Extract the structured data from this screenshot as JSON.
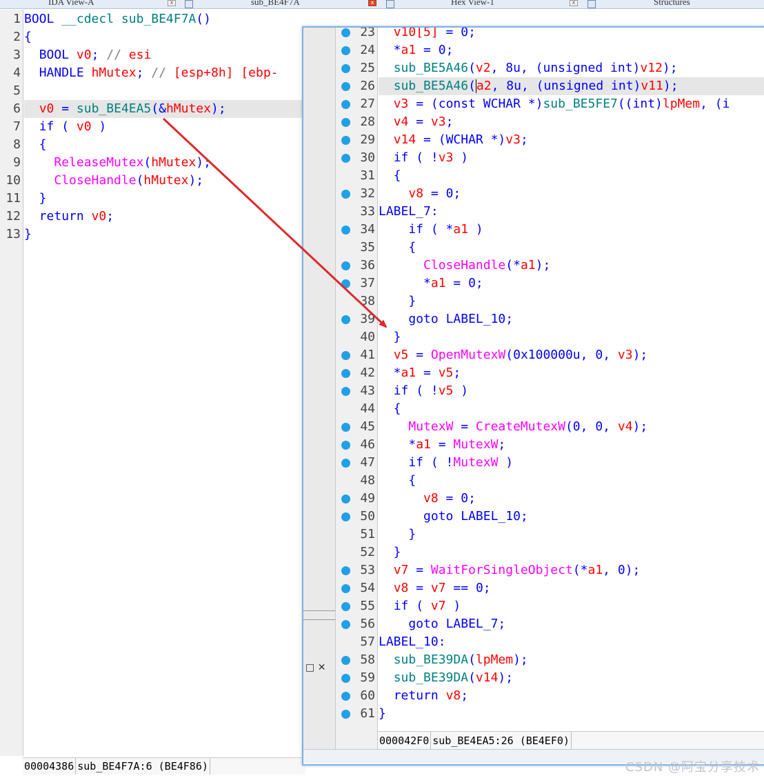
{
  "tabs": [
    {
      "label": "IDA View-A"
    },
    {
      "label": "sub_BE4F7A"
    },
    {
      "label": "Hex View-1"
    },
    {
      "label": "Structures"
    }
  ],
  "left_pane": {
    "lines": [
      {
        "num": "1",
        "tokens": [
          [
            "t",
            "BOOL"
          ],
          [
            "p",
            " "
          ],
          [
            "f",
            "__cdecl"
          ],
          [
            "p",
            " "
          ],
          [
            "f",
            "sub_BE4F7A"
          ],
          [
            "p",
            "()"
          ]
        ]
      },
      {
        "num": "2",
        "tokens": [
          [
            "p",
            "{"
          ]
        ]
      },
      {
        "num": "3",
        "tokens": [
          [
            "p",
            "  "
          ],
          [
            "t",
            "BOOL"
          ],
          [
            "p",
            " "
          ],
          [
            "v",
            "v0"
          ],
          [
            "p",
            "; "
          ],
          [
            "c",
            "// "
          ],
          [
            "cr",
            "esi"
          ]
        ]
      },
      {
        "num": "4",
        "tokens": [
          [
            "p",
            "  "
          ],
          [
            "t",
            "HANDLE"
          ],
          [
            "p",
            " "
          ],
          [
            "v",
            "hMutex"
          ],
          [
            "p",
            "; "
          ],
          [
            "c",
            "// "
          ],
          [
            "cr",
            "[esp+8h] [ebp-"
          ]
        ]
      },
      {
        "num": "5",
        "tokens": []
      },
      {
        "num": "6",
        "highlight": true,
        "tokens": [
          [
            "p",
            "  "
          ],
          [
            "v",
            "v0"
          ],
          [
            "p",
            " = "
          ],
          [
            "f",
            "sub_BE4EA5"
          ],
          [
            "p",
            "(&"
          ],
          [
            "v",
            "hMutex"
          ],
          [
            "p",
            ");"
          ]
        ]
      },
      {
        "num": "7",
        "tokens": [
          [
            "p",
            "  "
          ],
          [
            "k",
            "if"
          ],
          [
            "p",
            " ( "
          ],
          [
            "v",
            "v0"
          ],
          [
            "p",
            " )"
          ]
        ]
      },
      {
        "num": "8",
        "tokens": [
          [
            "p",
            "  {"
          ]
        ]
      },
      {
        "num": "9",
        "tokens": [
          [
            "p",
            "    "
          ],
          [
            "api",
            "ReleaseMutex"
          ],
          [
            "p",
            "("
          ],
          [
            "v",
            "hMutex"
          ],
          [
            "p",
            ");"
          ]
        ]
      },
      {
        "num": "10",
        "tokens": [
          [
            "p",
            "    "
          ],
          [
            "api",
            "CloseHandle"
          ],
          [
            "p",
            "("
          ],
          [
            "v",
            "hMutex"
          ],
          [
            "p",
            ");"
          ]
        ]
      },
      {
        "num": "11",
        "tokens": [
          [
            "p",
            "  }"
          ]
        ]
      },
      {
        "num": "12",
        "tokens": [
          [
            "p",
            "  "
          ],
          [
            "k",
            "return"
          ],
          [
            "p",
            " "
          ],
          [
            "v",
            "v0"
          ],
          [
            "p",
            ";"
          ]
        ]
      },
      {
        "num": "13",
        "tokens": [
          [
            "p",
            "}"
          ]
        ]
      }
    ],
    "status": {
      "address": "00004386",
      "location": "sub_BE4F7A:6",
      "ea": "(BE4F86)"
    }
  },
  "popup": {
    "lines": [
      {
        "num": "23",
        "dot": true,
        "tokens": [
          [
            "p",
            "  "
          ],
          [
            "v",
            "v10[5]"
          ],
          [
            "p",
            " = "
          ],
          [
            "n",
            "0"
          ],
          [
            "p",
            ";"
          ]
        ]
      },
      {
        "num": "24",
        "dot": true,
        "tokens": [
          [
            "p",
            "  *"
          ],
          [
            "v",
            "a1"
          ],
          [
            "p",
            " = "
          ],
          [
            "n",
            "0"
          ],
          [
            "p",
            ";"
          ]
        ]
      },
      {
        "num": "25",
        "dot": true,
        "tokens": [
          [
            "p",
            "  "
          ],
          [
            "f",
            "sub_BE5A46"
          ],
          [
            "p",
            "("
          ],
          [
            "v",
            "v2"
          ],
          [
            "p",
            ", "
          ],
          [
            "n",
            "8u"
          ],
          [
            "p",
            ", ("
          ],
          [
            "t",
            "unsigned int"
          ],
          [
            "p",
            ")"
          ],
          [
            "v",
            "v12"
          ],
          [
            "p",
            ");"
          ]
        ]
      },
      {
        "num": "26",
        "dot": true,
        "highlight": true,
        "caret": true,
        "tokens": [
          [
            "p",
            "  "
          ],
          [
            "f",
            "sub_BE5A46"
          ],
          [
            "p",
            "("
          ],
          [
            "caret",
            ""
          ],
          [
            "v",
            "a2"
          ],
          [
            "p",
            ", "
          ],
          [
            "n",
            "8u"
          ],
          [
            "p",
            ", ("
          ],
          [
            "t",
            "unsigned int"
          ],
          [
            "p",
            ")"
          ],
          [
            "v",
            "v11"
          ],
          [
            "p",
            ");"
          ]
        ]
      },
      {
        "num": "27",
        "dot": true,
        "tokens": [
          [
            "p",
            "  "
          ],
          [
            "v",
            "v3"
          ],
          [
            "p",
            " = ("
          ],
          [
            "t",
            "const"
          ],
          [
            "p",
            " "
          ],
          [
            "t",
            "WCHAR"
          ],
          [
            "p",
            " *)"
          ],
          [
            "f",
            "sub_BE5FE7"
          ],
          [
            "p",
            "(("
          ],
          [
            "t",
            "int"
          ],
          [
            "p",
            ")"
          ],
          [
            "v",
            "lpMem"
          ],
          [
            "p",
            ", (i"
          ]
        ]
      },
      {
        "num": "28",
        "dot": true,
        "tokens": [
          [
            "p",
            "  "
          ],
          [
            "v",
            "v4"
          ],
          [
            "p",
            " = "
          ],
          [
            "v",
            "v3"
          ],
          [
            "p",
            ";"
          ]
        ]
      },
      {
        "num": "29",
        "dot": true,
        "tokens": [
          [
            "p",
            "  "
          ],
          [
            "v",
            "v14"
          ],
          [
            "p",
            " = ("
          ],
          [
            "t",
            "WCHAR"
          ],
          [
            "p",
            " *)"
          ],
          [
            "v",
            "v3"
          ],
          [
            "p",
            ";"
          ]
        ]
      },
      {
        "num": "30",
        "dot": true,
        "tokens": [
          [
            "p",
            "  "
          ],
          [
            "k",
            "if"
          ],
          [
            "p",
            " ( !"
          ],
          [
            "v",
            "v3"
          ],
          [
            "p",
            " )"
          ]
        ]
      },
      {
        "num": "31",
        "dot": false,
        "tokens": [
          [
            "p",
            "  {"
          ]
        ]
      },
      {
        "num": "32",
        "dot": true,
        "tokens": [
          [
            "p",
            "    "
          ],
          [
            "v",
            "v8"
          ],
          [
            "p",
            " = "
          ],
          [
            "n",
            "0"
          ],
          [
            "p",
            ";"
          ]
        ]
      },
      {
        "num": "33",
        "dot": false,
        "tokens": [
          [
            "lbl",
            "LABEL_7"
          ],
          [
            "p",
            ":"
          ]
        ]
      },
      {
        "num": "34",
        "dot": true,
        "tokens": [
          [
            "p",
            "    "
          ],
          [
            "k",
            "if"
          ],
          [
            "p",
            " ( *"
          ],
          [
            "v",
            "a1"
          ],
          [
            "p",
            " )"
          ]
        ]
      },
      {
        "num": "35",
        "dot": false,
        "tokens": [
          [
            "p",
            "    {"
          ]
        ]
      },
      {
        "num": "36",
        "dot": true,
        "tokens": [
          [
            "p",
            "      "
          ],
          [
            "api",
            "CloseHandle"
          ],
          [
            "p",
            "(*"
          ],
          [
            "v",
            "a1"
          ],
          [
            "p",
            ");"
          ]
        ]
      },
      {
        "num": "37",
        "dot": true,
        "tokens": [
          [
            "p",
            "      *"
          ],
          [
            "v",
            "a1"
          ],
          [
            "p",
            " = "
          ],
          [
            "n",
            "0"
          ],
          [
            "p",
            ";"
          ]
        ]
      },
      {
        "num": "38",
        "dot": false,
        "tokens": [
          [
            "p",
            "    }"
          ]
        ]
      },
      {
        "num": "39",
        "dot": true,
        "tokens": [
          [
            "p",
            "    "
          ],
          [
            "k",
            "goto"
          ],
          [
            "p",
            " "
          ],
          [
            "lbl",
            "LABEL_10"
          ],
          [
            "p",
            ";"
          ]
        ]
      },
      {
        "num": "40",
        "dot": false,
        "tokens": [
          [
            "p",
            "  }"
          ]
        ]
      },
      {
        "num": "41",
        "dot": true,
        "tokens": [
          [
            "p",
            "  "
          ],
          [
            "v",
            "v5"
          ],
          [
            "p",
            " = "
          ],
          [
            "api",
            "OpenMutexW"
          ],
          [
            "p",
            "("
          ],
          [
            "n",
            "0x100000u"
          ],
          [
            "p",
            ", "
          ],
          [
            "n",
            "0"
          ],
          [
            "p",
            ", "
          ],
          [
            "v",
            "v3"
          ],
          [
            "p",
            ");"
          ]
        ]
      },
      {
        "num": "42",
        "dot": true,
        "tokens": [
          [
            "p",
            "  *"
          ],
          [
            "v",
            "a1"
          ],
          [
            "p",
            " = "
          ],
          [
            "v",
            "v5"
          ],
          [
            "p",
            ";"
          ]
        ]
      },
      {
        "num": "43",
        "dot": true,
        "tokens": [
          [
            "p",
            "  "
          ],
          [
            "k",
            "if"
          ],
          [
            "p",
            " ( !"
          ],
          [
            "v",
            "v5"
          ],
          [
            "p",
            " )"
          ]
        ]
      },
      {
        "num": "44",
        "dot": false,
        "tokens": [
          [
            "p",
            "  {"
          ]
        ]
      },
      {
        "num": "45",
        "dot": true,
        "tokens": [
          [
            "p",
            "    "
          ],
          [
            "api",
            "MutexW"
          ],
          [
            "p",
            " = "
          ],
          [
            "api",
            "CreateMutexW"
          ],
          [
            "p",
            "("
          ],
          [
            "n",
            "0"
          ],
          [
            "p",
            ", "
          ],
          [
            "n",
            "0"
          ],
          [
            "p",
            ", "
          ],
          [
            "v",
            "v4"
          ],
          [
            "p",
            ");"
          ]
        ]
      },
      {
        "num": "46",
        "dot": true,
        "tokens": [
          [
            "p",
            "    *"
          ],
          [
            "v",
            "a1"
          ],
          [
            "p",
            " = "
          ],
          [
            "api",
            "MutexW"
          ],
          [
            "p",
            ";"
          ]
        ]
      },
      {
        "num": "47",
        "dot": true,
        "tokens": [
          [
            "p",
            "    "
          ],
          [
            "k",
            "if"
          ],
          [
            "p",
            " ( !"
          ],
          [
            "api",
            "MutexW"
          ],
          [
            "p",
            " )"
          ]
        ]
      },
      {
        "num": "48",
        "dot": false,
        "tokens": [
          [
            "p",
            "    {"
          ]
        ]
      },
      {
        "num": "49",
        "dot": true,
        "tokens": [
          [
            "p",
            "      "
          ],
          [
            "v",
            "v8"
          ],
          [
            "p",
            " = "
          ],
          [
            "n",
            "0"
          ],
          [
            "p",
            ";"
          ]
        ]
      },
      {
        "num": "50",
        "dot": true,
        "tokens": [
          [
            "p",
            "      "
          ],
          [
            "k",
            "goto"
          ],
          [
            "p",
            " "
          ],
          [
            "lbl",
            "LABEL_10"
          ],
          [
            "p",
            ";"
          ]
        ]
      },
      {
        "num": "51",
        "dot": false,
        "tokens": [
          [
            "p",
            "    }"
          ]
        ]
      },
      {
        "num": "52",
        "dot": false,
        "tokens": [
          [
            "p",
            "  }"
          ]
        ]
      },
      {
        "num": "53",
        "dot": true,
        "tokens": [
          [
            "p",
            "  "
          ],
          [
            "v",
            "v7"
          ],
          [
            "p",
            " = "
          ],
          [
            "api",
            "WaitForSingleObject"
          ],
          [
            "p",
            "(*"
          ],
          [
            "v",
            "a1"
          ],
          [
            "p",
            ", "
          ],
          [
            "n",
            "0"
          ],
          [
            "p",
            ");"
          ]
        ]
      },
      {
        "num": "54",
        "dot": true,
        "tokens": [
          [
            "p",
            "  "
          ],
          [
            "v",
            "v8"
          ],
          [
            "p",
            " = "
          ],
          [
            "v",
            "v7"
          ],
          [
            "p",
            " == "
          ],
          [
            "n",
            "0"
          ],
          [
            "p",
            ";"
          ]
        ]
      },
      {
        "num": "55",
        "dot": true,
        "tokens": [
          [
            "p",
            "  "
          ],
          [
            "k",
            "if"
          ],
          [
            "p",
            " ( "
          ],
          [
            "v",
            "v7"
          ],
          [
            "p",
            " )"
          ]
        ]
      },
      {
        "num": "56",
        "dot": true,
        "tokens": [
          [
            "p",
            "    "
          ],
          [
            "k",
            "goto"
          ],
          [
            "p",
            " "
          ],
          [
            "lbl",
            "LABEL_7"
          ],
          [
            "p",
            ";"
          ]
        ]
      },
      {
        "num": "57",
        "dot": false,
        "tokens": [
          [
            "lbl",
            "LABEL_10"
          ],
          [
            "p",
            ":"
          ]
        ]
      },
      {
        "num": "58",
        "dot": true,
        "tokens": [
          [
            "p",
            "  "
          ],
          [
            "f",
            "sub_BE39DA"
          ],
          [
            "p",
            "("
          ],
          [
            "v",
            "lpMem"
          ],
          [
            "p",
            ");"
          ]
        ]
      },
      {
        "num": "59",
        "dot": true,
        "tokens": [
          [
            "p",
            "  "
          ],
          [
            "f",
            "sub_BE39DA"
          ],
          [
            "p",
            "("
          ],
          [
            "v",
            "v14"
          ],
          [
            "p",
            ");"
          ]
        ]
      },
      {
        "num": "60",
        "dot": true,
        "tokens": [
          [
            "p",
            "  "
          ],
          [
            "k",
            "return"
          ],
          [
            "p",
            " "
          ],
          [
            "v",
            "v8"
          ],
          [
            "p",
            ";"
          ]
        ]
      },
      {
        "num": "61",
        "dot": true,
        "tokens": [
          [
            "p",
            "}"
          ]
        ]
      }
    ],
    "status": {
      "address": "000042F0",
      "location": "sub_BE4EA5:26",
      "ea": "(BE4EF0)"
    }
  },
  "dock_icons": {
    "restore": "□",
    "close": "✕"
  },
  "watermark": "CSDN @阿宝分享技术",
  "colors": {
    "arrow": "#e0282a",
    "breakpoint_dot": "#21a0e6",
    "window_border": "#7fb0e0"
  }
}
